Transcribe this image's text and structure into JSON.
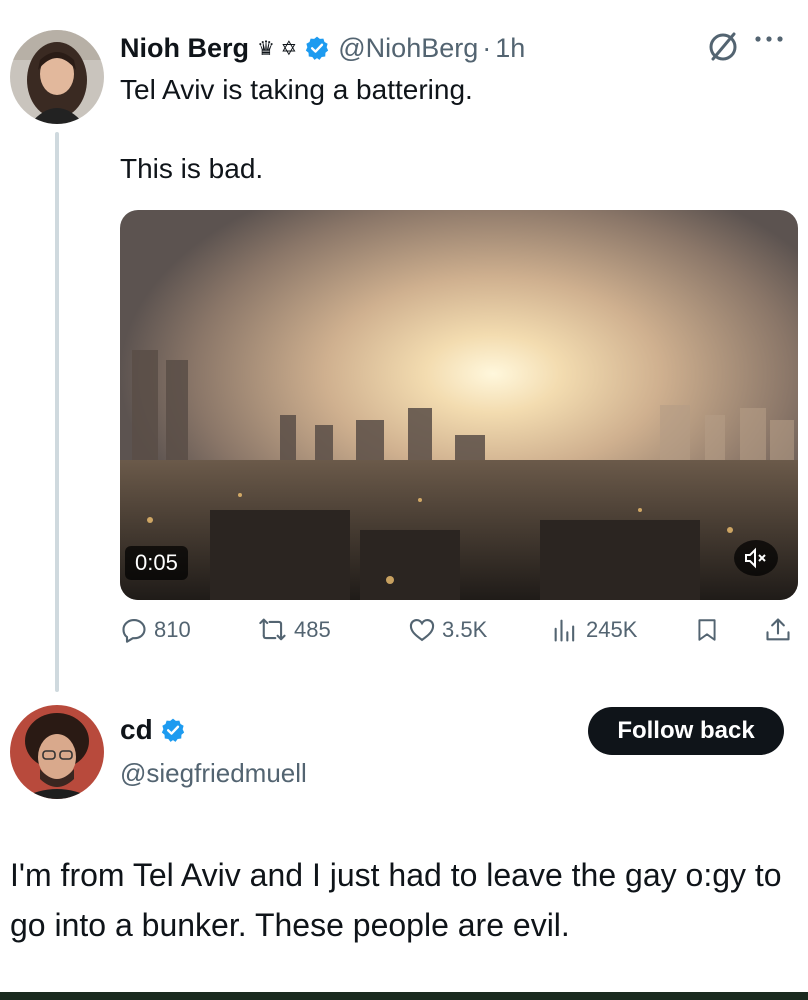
{
  "tweet": {
    "author_name": "Nioh Berg",
    "name_emojis": "♛ ✡",
    "handle": "@NiohBerg",
    "separator": "·",
    "time": "1h",
    "text_line1": "Tel Aviv is taking a battering.",
    "text_line2": "This is bad.",
    "video_duration": "0:05",
    "stats": {
      "replies": "810",
      "reposts": "485",
      "likes": "3.5K",
      "views": "245K"
    }
  },
  "reply": {
    "author_name": "cd",
    "handle": "@siegfriedmuell",
    "follow_label": "Follow back",
    "text": "I'm from Tel Aviv and I just had to leave the gay o:gy to go into a bunker.  These people are evil."
  },
  "colors": {
    "verified": "#1d9bf0",
    "secondary_text": "#536471",
    "primary_text": "#0f1419"
  },
  "icons": [
    "verified-icon",
    "mute-icon",
    "reply-icon",
    "repost-icon",
    "like-icon",
    "views-icon",
    "bookmark-icon",
    "share-icon",
    "more-icon",
    "no-symbol-icon"
  ]
}
